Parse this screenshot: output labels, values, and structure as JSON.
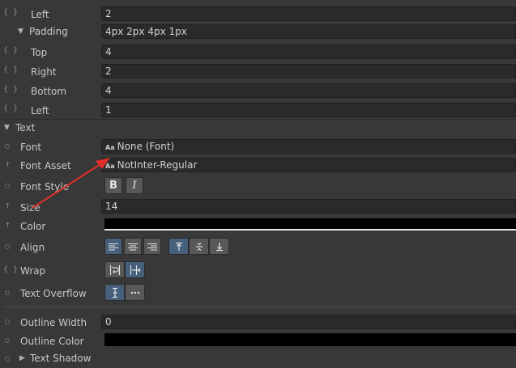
{
  "margin_left": {
    "label": "Left",
    "value": "2"
  },
  "padding": {
    "label": "Padding",
    "value": "4px 2px 4px 1px",
    "top": {
      "label": "Top",
      "value": "4"
    },
    "right": {
      "label": "Right",
      "value": "2"
    },
    "bottom": {
      "label": "Bottom",
      "value": "4"
    },
    "left": {
      "label": "Left",
      "value": "1"
    }
  },
  "text_section": {
    "title": "Text",
    "font": {
      "label": "Font",
      "prefix": "Aa",
      "value": "None (Font)"
    },
    "font_asset": {
      "label": "Font Asset",
      "prefix": "Aa",
      "value": "NotInter-Regular"
    },
    "font_style": {
      "label": "Font Style",
      "bold": "B",
      "italic": "I"
    },
    "size": {
      "label": "Size",
      "value": "14"
    },
    "color": {
      "label": "Color",
      "swatch": "#000000"
    },
    "align": {
      "label": "Align"
    },
    "wrap": {
      "label": "Wrap"
    },
    "text_overflow": {
      "label": "Text Overflow"
    },
    "outline_width": {
      "label": "Outline Width",
      "value": "0"
    },
    "outline_color": {
      "label": "Outline Color",
      "swatch": "#000000"
    },
    "text_shadow": {
      "label": "Text Shadow"
    }
  },
  "colors": {
    "panel": "#383838",
    "field": "#2a2a2a",
    "button": "#585858",
    "button_active": "#46607c",
    "annotation_arrow": "#e0302a"
  }
}
